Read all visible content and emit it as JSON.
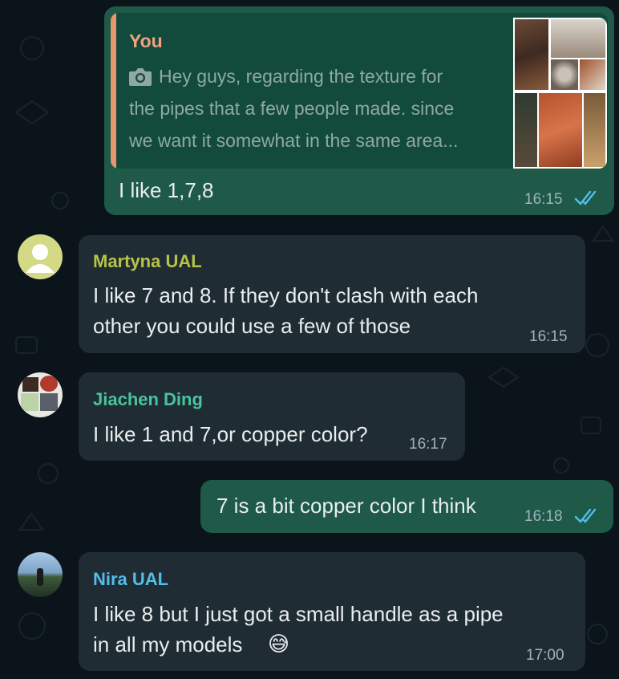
{
  "colors": {
    "chat_bg": "#0b141a",
    "outgoing_bubble": "#1e5a47",
    "incoming_bubble": "#202c33",
    "read_ticks": "#53bdeb",
    "quote_accent": "#e7966d"
  },
  "messages": [
    {
      "direction": "outgoing",
      "quote": {
        "sender": "You",
        "icon": "camera-icon",
        "lines": [
          "Hey guys, regarding the texture for",
          "the pipes that a few people made. since",
          "we want it somewhat in the same area..."
        ]
      },
      "text": "I like 1,7,8",
      "time": "16:15",
      "status": "read"
    },
    {
      "direction": "incoming",
      "sender": "Martyna UAL",
      "sender_color": "#b7c346",
      "lines": [
        "I like 7 and 8. If they don't clash with each",
        "other you could use a few of those"
      ],
      "time": "16:15"
    },
    {
      "direction": "incoming",
      "sender": "Jiachen Ding",
      "sender_color": "#49c39d",
      "lines": [
        "I like 1 and 7,or copper color?"
      ],
      "time": "16:17"
    },
    {
      "direction": "outgoing",
      "text": "7 is a bit copper color I think",
      "time": "16:18",
      "status": "read"
    },
    {
      "direction": "incoming",
      "sender": "Nira UAL",
      "sender_color": "#53bdeb",
      "lines": [
        "I like 8 but I just got a small handle as a pipe",
        "in all my models"
      ],
      "emoji": "😅",
      "time": "17:00"
    }
  ]
}
